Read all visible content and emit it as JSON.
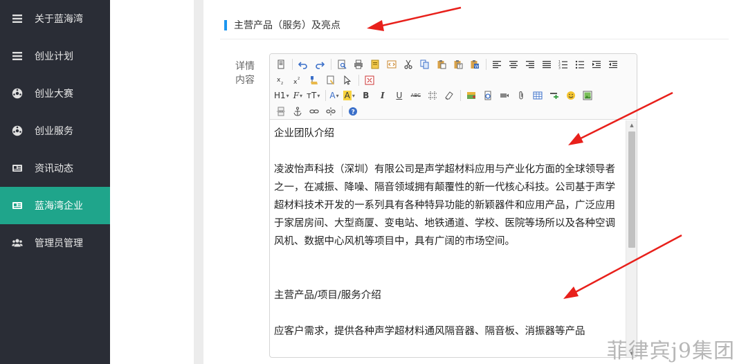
{
  "sidebar": {
    "items": [
      {
        "label": "关于蓝海湾",
        "icon": "list-icon",
        "active": false
      },
      {
        "label": "创业计划",
        "icon": "list-icon",
        "active": false
      },
      {
        "label": "创业大赛",
        "icon": "soccer-ball-icon",
        "active": false
      },
      {
        "label": "创业服务",
        "icon": "soccer-ball-icon",
        "active": false
      },
      {
        "label": "资讯动态",
        "icon": "newspaper-icon",
        "active": false
      },
      {
        "label": "蓝海湾企业",
        "icon": "newspaper-icon",
        "active": true
      },
      {
        "label": "管理员管理",
        "icon": "users-icon",
        "active": false
      }
    ],
    "active_color": "#1fa58b",
    "bg_color": "#2a2d36"
  },
  "section": {
    "title": "主营产品（服务）及亮点",
    "accent_color": "#1c96f0"
  },
  "form": {
    "field_label": "详情内容"
  },
  "editor": {
    "toolbar": {
      "heading_drop": "H1",
      "font_drop": "F",
      "size_drop": "тT",
      "text_color": "A",
      "highlight": "A",
      "bold": "B",
      "italic": "I",
      "underline": "U",
      "strike": "ABC"
    },
    "content": {
      "heading1": "企业团队介绍",
      "para1": "凌波怡声科技（深圳）有限公司是声学超材料应用与产业化方面的全球领导者之一，在减振、降噪、隔音领域拥有颠覆性的新一代核心科技。公司基于声学超材料技术开发的一系列具有各种特异功能的新颖器件和应用产品，广泛应用于家居房间、大型商厦、变电站、地铁通道、学校、医院等场所以及各种空调风机、数据中心风机等项目中，具有广阔的市场空间。",
      "heading2": "主营产品/项目/服务介绍",
      "para2": "应客户需求，提供各种声学超材料通风隔音器、隔音板、消振器等产品"
    }
  },
  "watermark": "菲律宾j9集团",
  "arrow_color": "#e8201b"
}
